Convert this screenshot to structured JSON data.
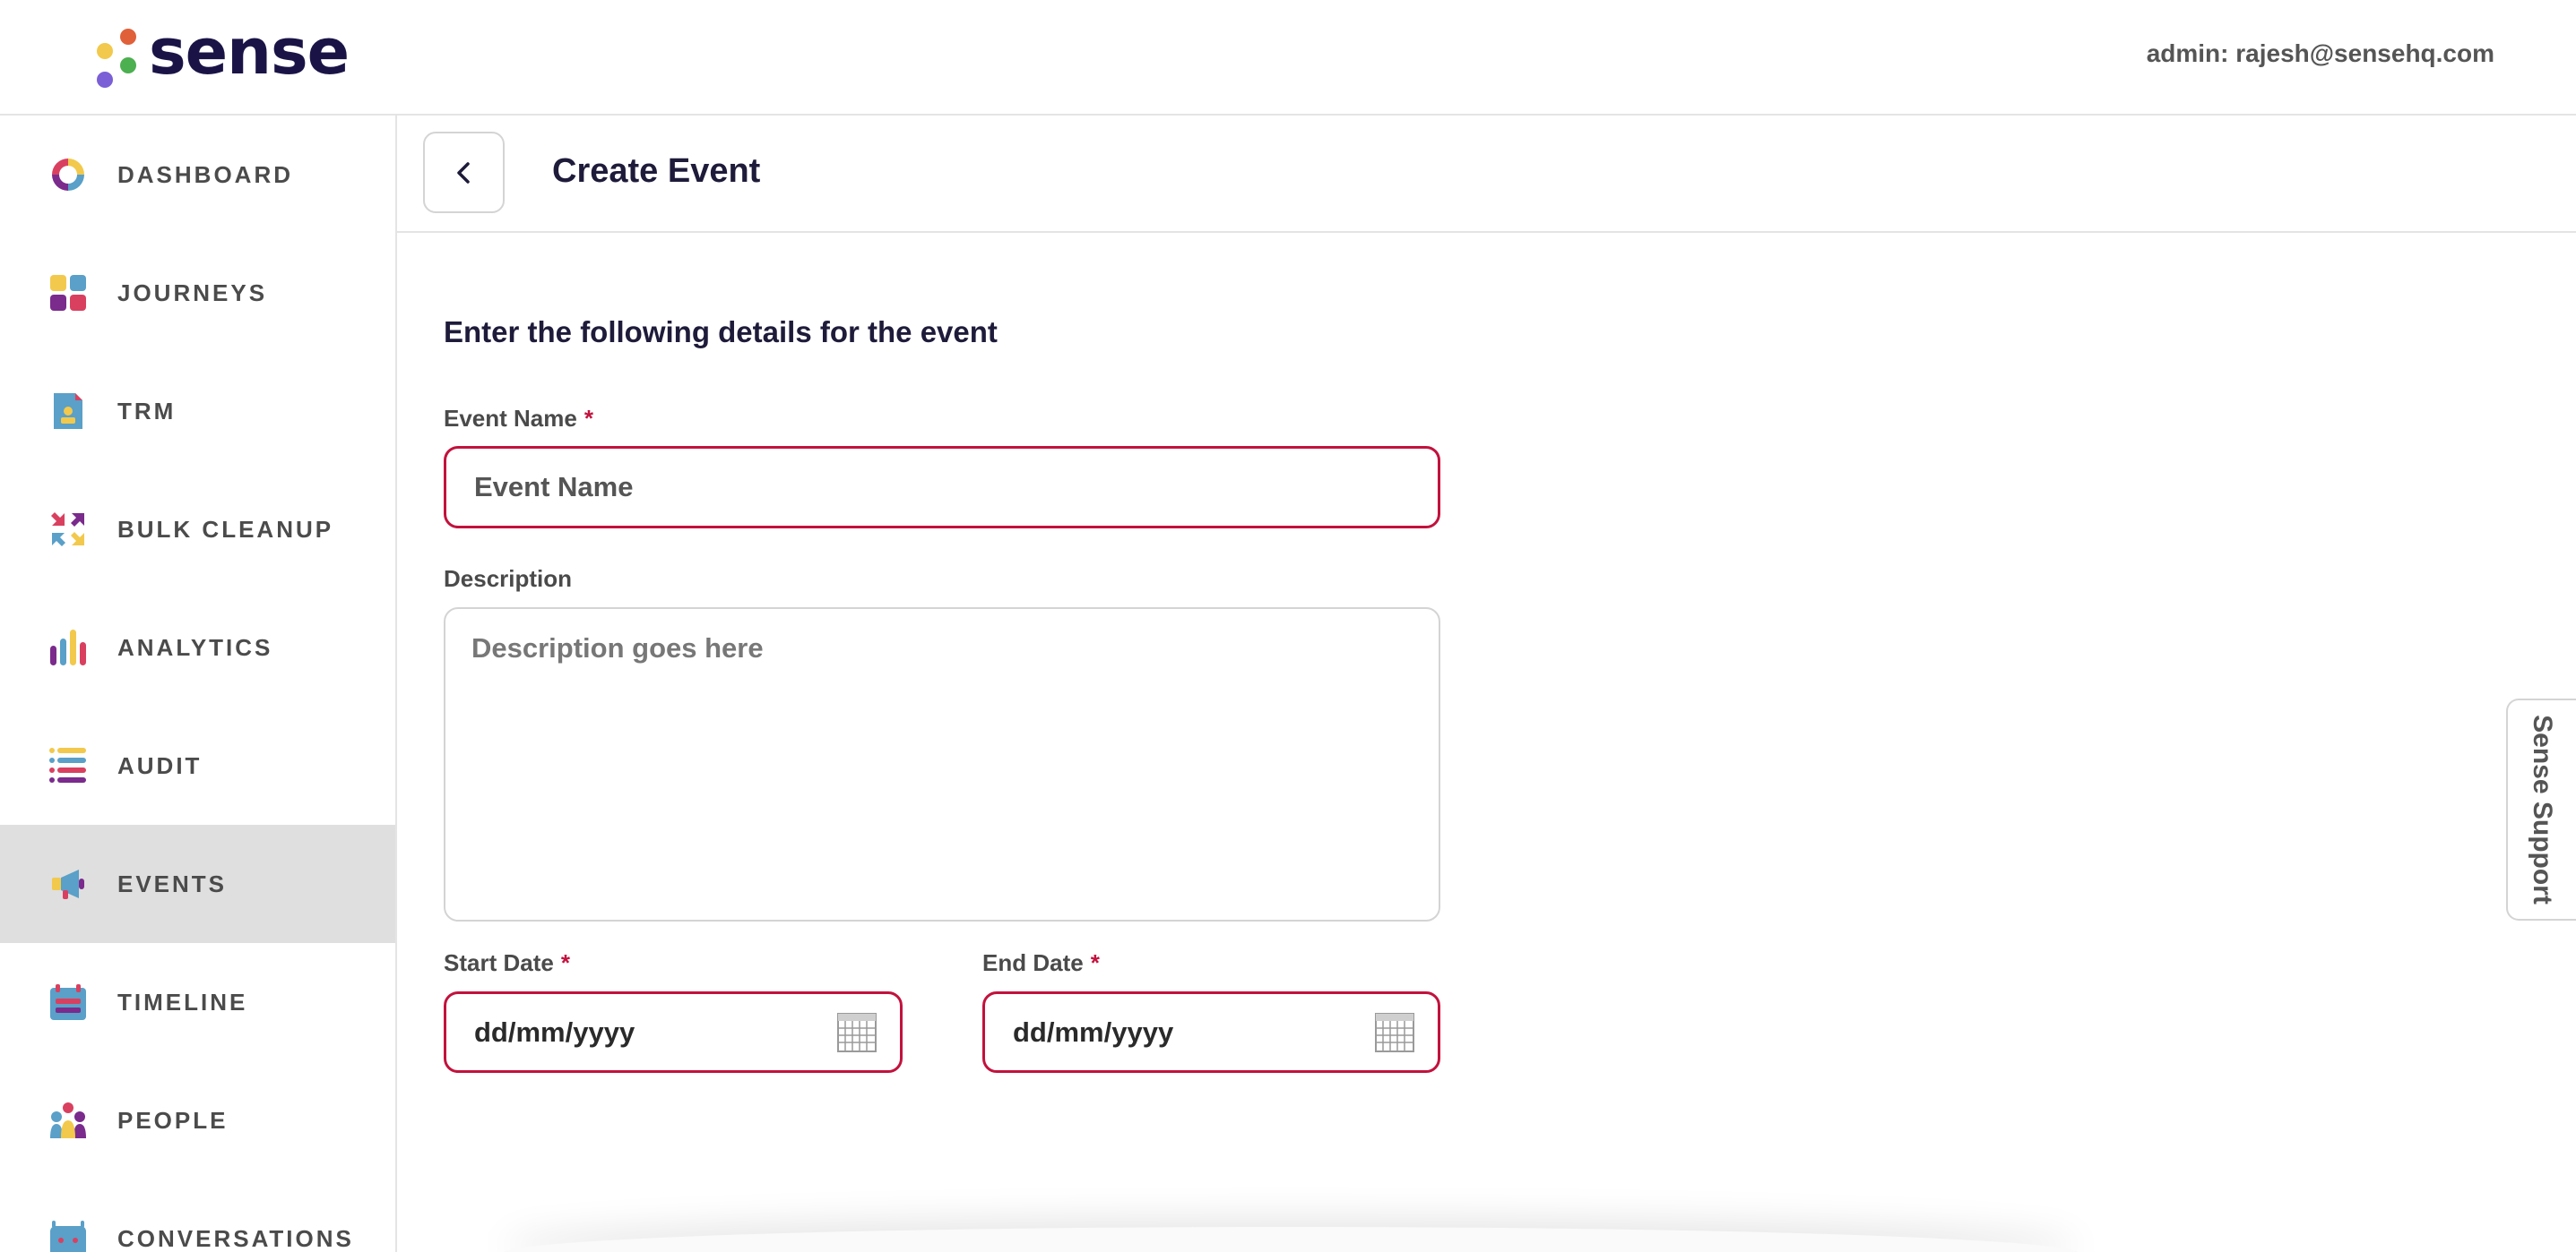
{
  "header": {
    "logo_text": "sense",
    "admin_label": "admin: rajesh@sensehq.com"
  },
  "sidebar": {
    "items": [
      {
        "label": "DASHBOARD",
        "icon": "dashboard-ring-icon"
      },
      {
        "label": "JOURNEYS",
        "icon": "journeys-grid-icon"
      },
      {
        "label": "TRM",
        "icon": "trm-document-icon"
      },
      {
        "label": "BULK CLEANUP",
        "icon": "bulk-cleanup-arrows-icon"
      },
      {
        "label": "ANALYTICS",
        "icon": "analytics-bars-icon"
      },
      {
        "label": "AUDIT",
        "icon": "audit-list-icon"
      },
      {
        "label": "EVENTS",
        "icon": "events-megaphone-icon",
        "active": true
      },
      {
        "label": "TIMELINE",
        "icon": "timeline-calendar-icon"
      },
      {
        "label": "PEOPLE",
        "icon": "people-group-icon"
      },
      {
        "label": "CONVERSATIONS",
        "icon": "conversations-chat-icon"
      }
    ]
  },
  "page": {
    "title": "Create Event",
    "back_icon": "chevron-left-icon"
  },
  "form": {
    "heading": "Enter the following details for the event",
    "event_name": {
      "label": "Event Name",
      "required_mark": "*",
      "value": "",
      "placeholder": "Event Name"
    },
    "description": {
      "label": "Description",
      "value": "",
      "placeholder": "Description goes here"
    },
    "start_date": {
      "label": "Start Date",
      "required_mark": "*",
      "value": "dd/mm/yyyy",
      "icon": "calendar-icon"
    },
    "end_date": {
      "label": "End Date",
      "required_mark": "*",
      "value": "dd/mm/yyyy",
      "icon": "calendar-icon"
    }
  },
  "support": {
    "label": "Sense Support"
  },
  "colors": {
    "brand_navy": "#1a1446",
    "error_red": "#c2123d",
    "active_bg": "#dfdfdf",
    "logo_orange": "#e0603a",
    "logo_yellow": "#f2c94c",
    "logo_green": "#4caf50",
    "logo_purple": "#7b5fd6"
  }
}
